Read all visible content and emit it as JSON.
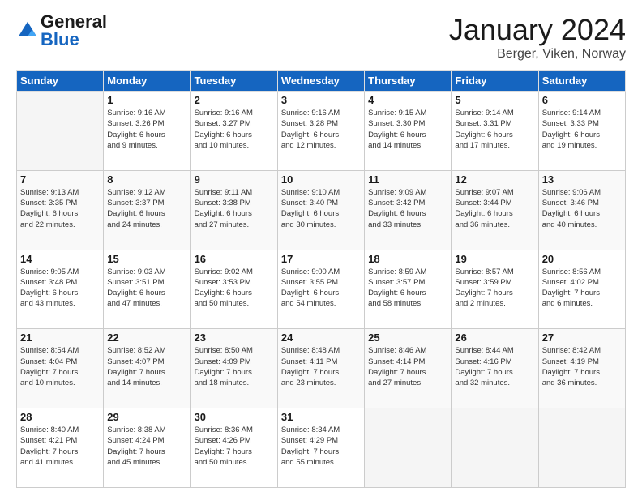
{
  "header": {
    "logo_general": "General",
    "logo_blue": "Blue",
    "month_year": "January 2024",
    "location": "Berger, Viken, Norway"
  },
  "days_of_week": [
    "Sunday",
    "Monday",
    "Tuesday",
    "Wednesday",
    "Thursday",
    "Friday",
    "Saturday"
  ],
  "weeks": [
    [
      {
        "day": "",
        "info": ""
      },
      {
        "day": "1",
        "info": "Sunrise: 9:16 AM\nSunset: 3:26 PM\nDaylight: 6 hours\nand 9 minutes."
      },
      {
        "day": "2",
        "info": "Sunrise: 9:16 AM\nSunset: 3:27 PM\nDaylight: 6 hours\nand 10 minutes."
      },
      {
        "day": "3",
        "info": "Sunrise: 9:16 AM\nSunset: 3:28 PM\nDaylight: 6 hours\nand 12 minutes."
      },
      {
        "day": "4",
        "info": "Sunrise: 9:15 AM\nSunset: 3:30 PM\nDaylight: 6 hours\nand 14 minutes."
      },
      {
        "day": "5",
        "info": "Sunrise: 9:14 AM\nSunset: 3:31 PM\nDaylight: 6 hours\nand 17 minutes."
      },
      {
        "day": "6",
        "info": "Sunrise: 9:14 AM\nSunset: 3:33 PM\nDaylight: 6 hours\nand 19 minutes."
      }
    ],
    [
      {
        "day": "7",
        "info": "Sunrise: 9:13 AM\nSunset: 3:35 PM\nDaylight: 6 hours\nand 22 minutes."
      },
      {
        "day": "8",
        "info": "Sunrise: 9:12 AM\nSunset: 3:37 PM\nDaylight: 6 hours\nand 24 minutes."
      },
      {
        "day": "9",
        "info": "Sunrise: 9:11 AM\nSunset: 3:38 PM\nDaylight: 6 hours\nand 27 minutes."
      },
      {
        "day": "10",
        "info": "Sunrise: 9:10 AM\nSunset: 3:40 PM\nDaylight: 6 hours\nand 30 minutes."
      },
      {
        "day": "11",
        "info": "Sunrise: 9:09 AM\nSunset: 3:42 PM\nDaylight: 6 hours\nand 33 minutes."
      },
      {
        "day": "12",
        "info": "Sunrise: 9:07 AM\nSunset: 3:44 PM\nDaylight: 6 hours\nand 36 minutes."
      },
      {
        "day": "13",
        "info": "Sunrise: 9:06 AM\nSunset: 3:46 PM\nDaylight: 6 hours\nand 40 minutes."
      }
    ],
    [
      {
        "day": "14",
        "info": "Sunrise: 9:05 AM\nSunset: 3:48 PM\nDaylight: 6 hours\nand 43 minutes."
      },
      {
        "day": "15",
        "info": "Sunrise: 9:03 AM\nSunset: 3:51 PM\nDaylight: 6 hours\nand 47 minutes."
      },
      {
        "day": "16",
        "info": "Sunrise: 9:02 AM\nSunset: 3:53 PM\nDaylight: 6 hours\nand 50 minutes."
      },
      {
        "day": "17",
        "info": "Sunrise: 9:00 AM\nSunset: 3:55 PM\nDaylight: 6 hours\nand 54 minutes."
      },
      {
        "day": "18",
        "info": "Sunrise: 8:59 AM\nSunset: 3:57 PM\nDaylight: 6 hours\nand 58 minutes."
      },
      {
        "day": "19",
        "info": "Sunrise: 8:57 AM\nSunset: 3:59 PM\nDaylight: 7 hours\nand 2 minutes."
      },
      {
        "day": "20",
        "info": "Sunrise: 8:56 AM\nSunset: 4:02 PM\nDaylight: 7 hours\nand 6 minutes."
      }
    ],
    [
      {
        "day": "21",
        "info": "Sunrise: 8:54 AM\nSunset: 4:04 PM\nDaylight: 7 hours\nand 10 minutes."
      },
      {
        "day": "22",
        "info": "Sunrise: 8:52 AM\nSunset: 4:07 PM\nDaylight: 7 hours\nand 14 minutes."
      },
      {
        "day": "23",
        "info": "Sunrise: 8:50 AM\nSunset: 4:09 PM\nDaylight: 7 hours\nand 18 minutes."
      },
      {
        "day": "24",
        "info": "Sunrise: 8:48 AM\nSunset: 4:11 PM\nDaylight: 7 hours\nand 23 minutes."
      },
      {
        "day": "25",
        "info": "Sunrise: 8:46 AM\nSunset: 4:14 PM\nDaylight: 7 hours\nand 27 minutes."
      },
      {
        "day": "26",
        "info": "Sunrise: 8:44 AM\nSunset: 4:16 PM\nDaylight: 7 hours\nand 32 minutes."
      },
      {
        "day": "27",
        "info": "Sunrise: 8:42 AM\nSunset: 4:19 PM\nDaylight: 7 hours\nand 36 minutes."
      }
    ],
    [
      {
        "day": "28",
        "info": "Sunrise: 8:40 AM\nSunset: 4:21 PM\nDaylight: 7 hours\nand 41 minutes."
      },
      {
        "day": "29",
        "info": "Sunrise: 8:38 AM\nSunset: 4:24 PM\nDaylight: 7 hours\nand 45 minutes."
      },
      {
        "day": "30",
        "info": "Sunrise: 8:36 AM\nSunset: 4:26 PM\nDaylight: 7 hours\nand 50 minutes."
      },
      {
        "day": "31",
        "info": "Sunrise: 8:34 AM\nSunset: 4:29 PM\nDaylight: 7 hours\nand 55 minutes."
      },
      {
        "day": "",
        "info": ""
      },
      {
        "day": "",
        "info": ""
      },
      {
        "day": "",
        "info": ""
      }
    ]
  ]
}
